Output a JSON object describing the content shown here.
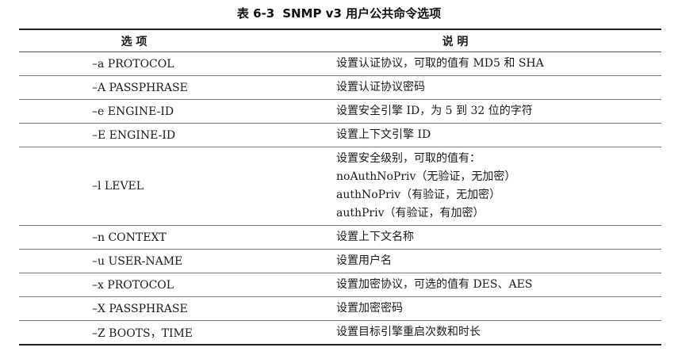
{
  "caption": {
    "number": "表 6-3",
    "title": "SNMP v3 用户公共命令选项"
  },
  "headers": {
    "option": "选 项",
    "description": "说 明"
  },
  "rows": [
    {
      "option": "–a PROTOCOL",
      "description": [
        "设置认证协议，可取的值有 MD5 和 SHA"
      ]
    },
    {
      "option": "–A PASSPHRASE",
      "description": [
        "设置认证协议密码"
      ]
    },
    {
      "option": "–e ENGINE-ID",
      "description": [
        "设置安全引擎 ID，为 5 到 32 位的字符"
      ]
    },
    {
      "option": "–E ENGINE-ID",
      "description": [
        "设置上下文引擎 ID"
      ]
    },
    {
      "option": "–l LEVEL",
      "description": [
        "设置安全级别，可取的值有：",
        "noAuthNoPriv（无验证，无加密）",
        "authNoPriv（有验证，无加密）",
        "authPriv（有验证，有加密）"
      ]
    },
    {
      "option": "–n CONTEXT",
      "description": [
        "设置上下文名称"
      ]
    },
    {
      "option": "–u USER-NAME",
      "description": [
        "设置用户名"
      ]
    },
    {
      "option": "–x PROTOCOL",
      "description": [
        "设置加密协议，可选的值有 DES、AES"
      ]
    },
    {
      "option": "–X PASSPHRASE",
      "description": [
        "设置加密密码"
      ]
    },
    {
      "option": "–Z BOOTS，TIME",
      "description": [
        "设置目标引擎重启次数和时长"
      ]
    }
  ]
}
